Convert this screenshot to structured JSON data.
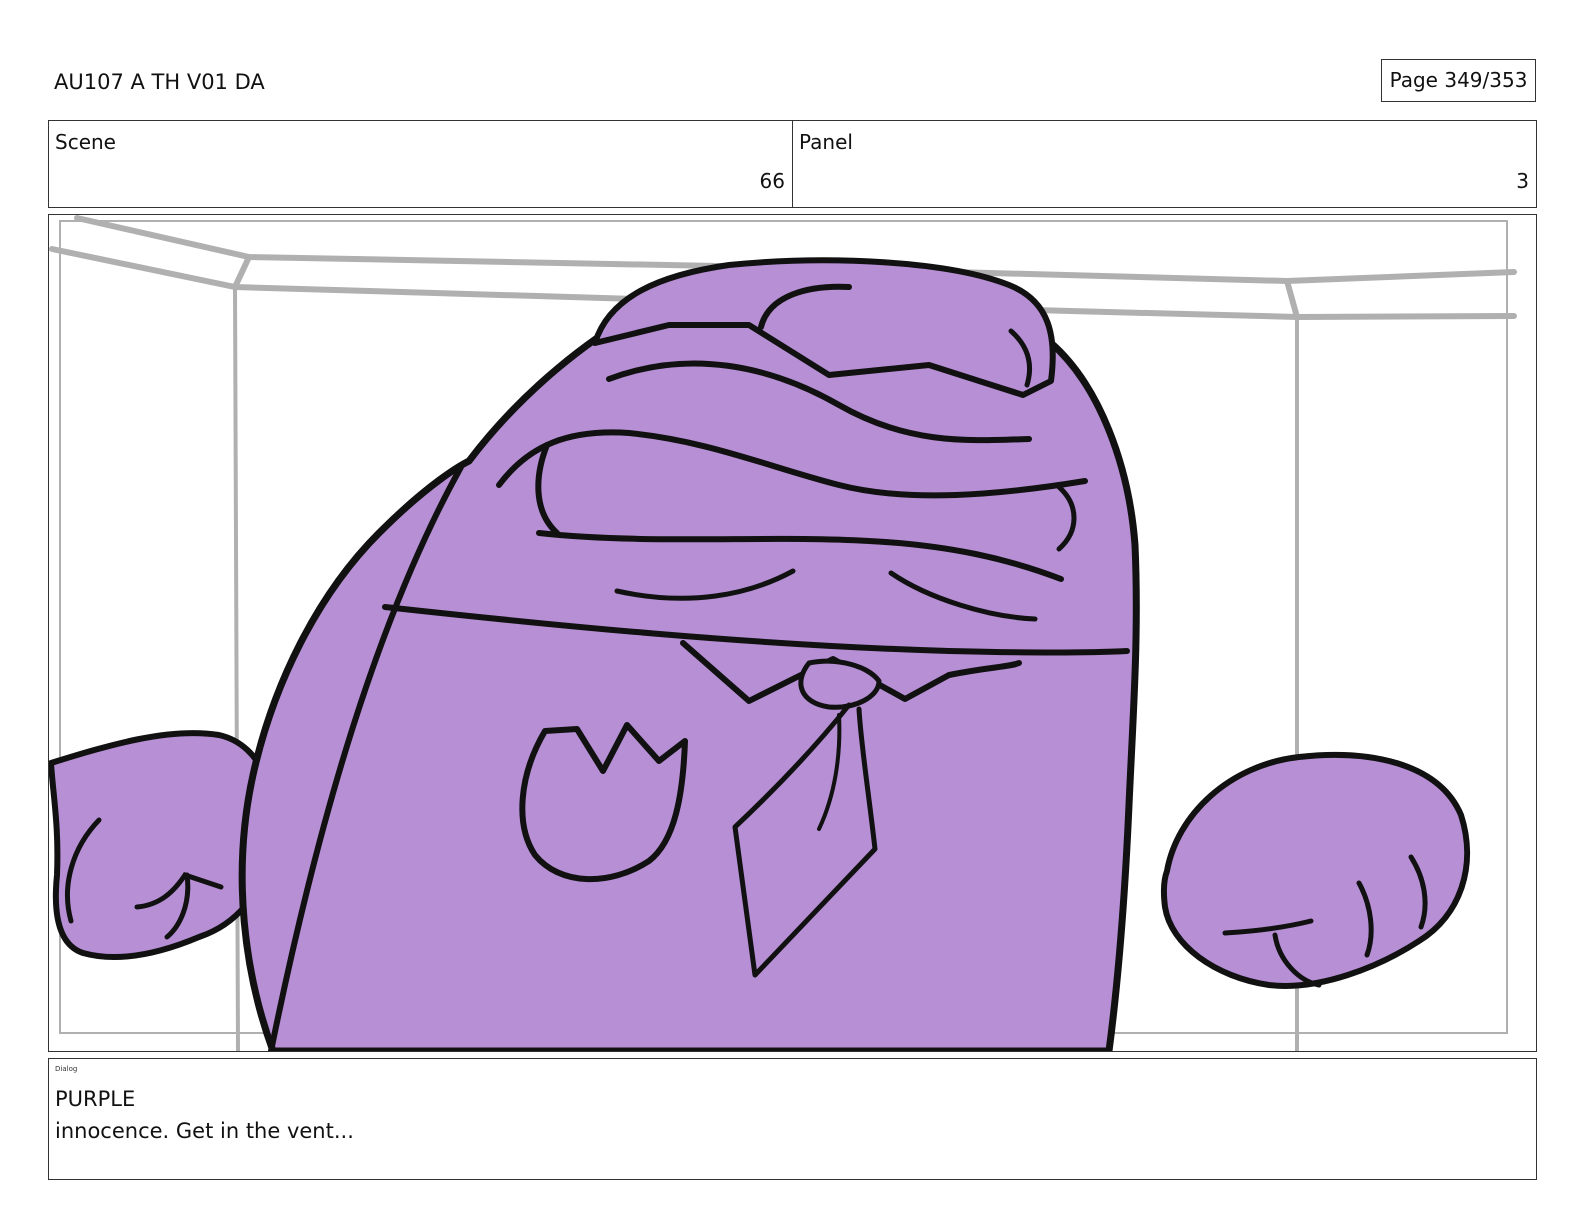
{
  "header": {
    "title": "AU107 A TH V01 DA",
    "page": "Page 349/353"
  },
  "info": {
    "scene_label": "Scene",
    "scene_value": "66",
    "panel_label": "Panel",
    "panel_value": "3"
  },
  "frame": {
    "character_color": "#b68fd5",
    "line_color": "#111111",
    "background_line_color": "#b0b0b0"
  },
  "dialog": {
    "label": "Dialog",
    "speaker": "PURPLE",
    "line": "innocence. Get in the vent..."
  }
}
